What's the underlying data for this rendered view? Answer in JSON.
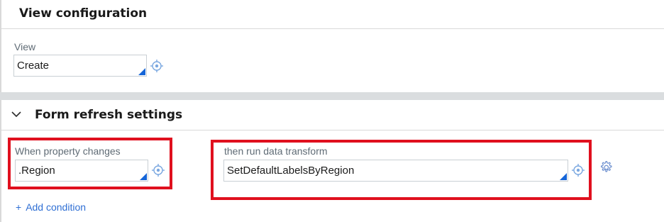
{
  "view_config": {
    "title": "View configuration",
    "field_label": "View",
    "field_value": "Create"
  },
  "form_refresh": {
    "title": "Form refresh settings",
    "when_label": "When property changes",
    "when_value": ".Region",
    "then_label": "then run data transform",
    "then_value": "SetDefaultLabelsByRegion",
    "add_condition": "Add condition",
    "add_symbol": "+"
  },
  "colors": {
    "highlight": "#e0101e",
    "link": "#2f6fd4",
    "corner_accent": "#1565d8"
  },
  "icons": [
    "target-icon",
    "gear-icon",
    "chevron-down-icon",
    "plus-icon"
  ]
}
